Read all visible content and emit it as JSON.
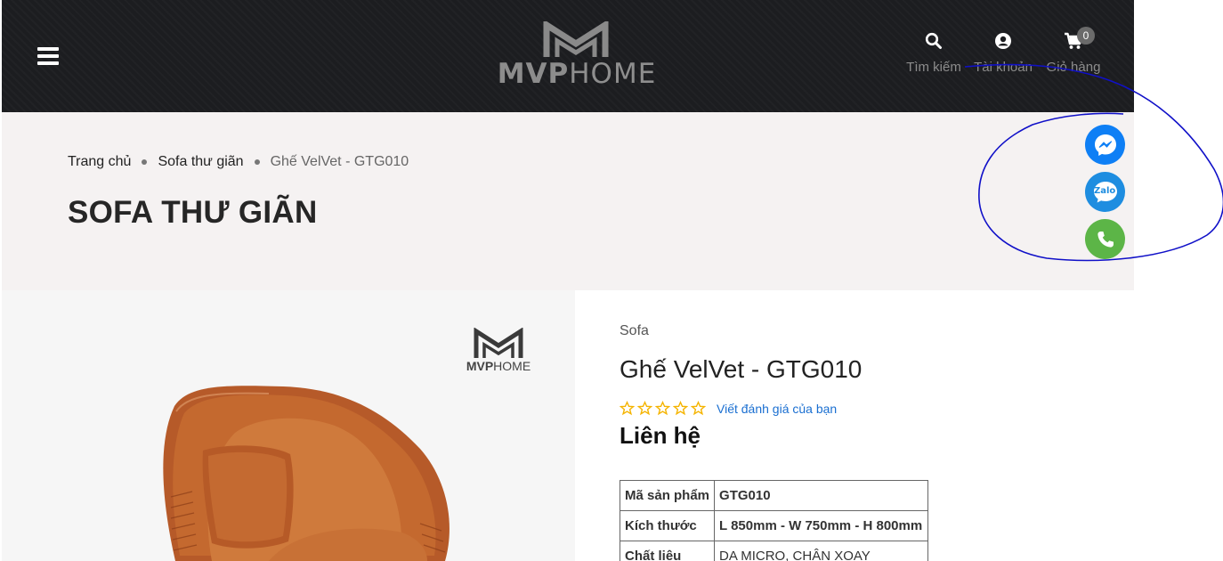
{
  "header": {
    "logo": {
      "brand_bold": "MVP",
      "brand_light": "HOME"
    },
    "search_label": "Tìm kiếm",
    "account_label": "Tài khoản",
    "cart_label": "Giỏ hàng",
    "cart_count": "0",
    "icons": {
      "menu": "hamburger-icon",
      "search": "search-icon",
      "account": "user-circle-icon",
      "cart": "cart-icon"
    }
  },
  "breadcrumb": [
    {
      "label": "Trang chủ"
    },
    {
      "label": "Sofa thư giãn"
    },
    {
      "label": "Ghế VelVet - GTG010"
    }
  ],
  "page_title": "SOFA THƯ GIÃN",
  "floating_contacts": [
    {
      "name": "messenger",
      "icon": "messenger-icon",
      "color": "#0e7ff5"
    },
    {
      "name": "zalo",
      "icon": "zalo-icon",
      "text": "Zalo",
      "color": "#1e8de0"
    },
    {
      "name": "phone",
      "icon": "phone-icon",
      "color": "#5cb547"
    }
  ],
  "product_image": {
    "watermark": {
      "brand_bold": "MVP",
      "brand_light": "HOME"
    }
  },
  "product": {
    "category": "Sofa",
    "name": "Ghế VelVet - GTG010",
    "rating": {
      "stars_filled": 0,
      "stars_total": 5,
      "review_link": "Viết đánh giá của bạn"
    },
    "price": "Liên hệ",
    "specs": [
      {
        "key": "Mã sản phẩm",
        "value": "GTG010"
      },
      {
        "key": "Kích thước",
        "value": "L 850mm - W 750mm - H 800mm"
      },
      {
        "key": "Chất liệu",
        "value": "DA MICRO, CHÂN XOAY"
      }
    ]
  },
  "colors": {
    "header_bg": "#1c1d20",
    "banner_bg": "#f5f2f2",
    "star": "#f5b400",
    "link": "#1a6fd1",
    "annotation": "#1010c8"
  }
}
